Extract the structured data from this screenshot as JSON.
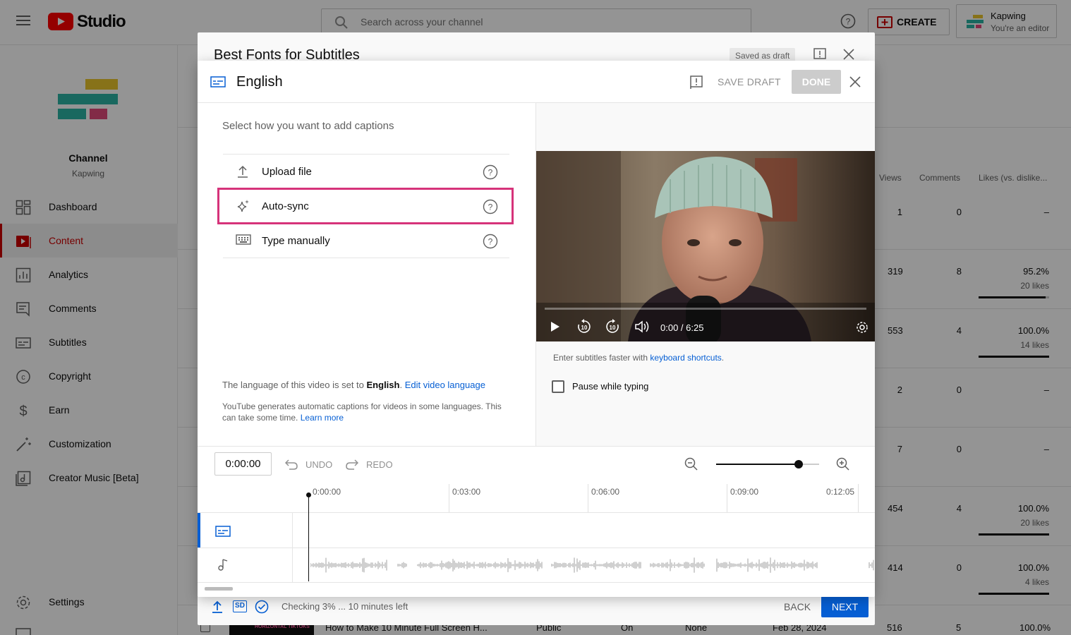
{
  "topbar": {
    "logo_text": "Studio",
    "search_placeholder": "Search across your channel",
    "create_label": "CREATE",
    "account_name": "Kapwing",
    "account_role": "You're an editor"
  },
  "sidebar": {
    "channel_label": "Channel",
    "channel_name": "Kapwing",
    "items": [
      {
        "label": "Dashboard",
        "icon": "dashboard-icon"
      },
      {
        "label": "Content",
        "icon": "content-icon"
      },
      {
        "label": "Analytics",
        "icon": "analytics-icon"
      },
      {
        "label": "Comments",
        "icon": "comments-icon"
      },
      {
        "label": "Subtitles",
        "icon": "subtitles-icon"
      },
      {
        "label": "Copyright",
        "icon": "copyright-icon"
      },
      {
        "label": "Earn",
        "icon": "dollar-icon"
      },
      {
        "label": "Customization",
        "icon": "magic-wand-icon"
      },
      {
        "label": "Creator Music [Beta]",
        "icon": "music-icon"
      }
    ],
    "settings_label": "Settings"
  },
  "table": {
    "headers": [
      "Views",
      "Comments",
      "Likes (vs. dislike..."
    ],
    "rows": [
      {
        "views": "1",
        "comments": "0",
        "likes": "–",
        "likes_sub": "",
        "ratio": null
      },
      {
        "views": "319",
        "comments": "8",
        "likes": "95.2%",
        "likes_sub": "20 likes",
        "ratio": 0.952
      },
      {
        "views": "553",
        "comments": "4",
        "likes": "100.0%",
        "likes_sub": "14 likes",
        "ratio": 1.0
      },
      {
        "views": "2",
        "comments": "0",
        "likes": "–",
        "likes_sub": "",
        "ratio": null
      },
      {
        "views": "7",
        "comments": "0",
        "likes": "–",
        "likes_sub": "",
        "ratio": null
      },
      {
        "views": "454",
        "comments": "4",
        "likes": "100.0%",
        "likes_sub": "20 likes",
        "ratio": 1.0
      },
      {
        "views": "414",
        "comments": "0",
        "likes": "100.0%",
        "likes_sub": "4 likes",
        "ratio": 1.0
      }
    ],
    "last_row": {
      "thumb_text": "HORIZONTAL TIKTOKS",
      "title": "How to Make 10 Minute Full Screen H...",
      "visibility": "Public",
      "monetization": "On",
      "restrictions": "None",
      "date": "Feb 28, 2024",
      "views": "516",
      "comments": "5",
      "likes": "100.0%"
    }
  },
  "back_dialog": {
    "title": "Best Fonts for Subtitles",
    "saved_status": "Saved as draft",
    "upload_status": "Checking 3% ... 10 minutes left",
    "back_label": "BACK",
    "next_label": "NEXT",
    "sd_badge": "SD"
  },
  "dialog": {
    "title": "English",
    "save_draft_label": "SAVE DRAFT",
    "done_label": "DONE",
    "prompt": "Select how you want to add captions",
    "options": [
      {
        "label": "Upload file",
        "icon": "upload-icon"
      },
      {
        "label": "Auto-sync",
        "icon": "sparkle-icon"
      },
      {
        "label": "Type manually",
        "icon": "keyboard-icon"
      }
    ],
    "language_prefix": "The language of this video is set to ",
    "language_value": "English",
    "language_suffix": ".",
    "edit_language_link": "Edit video language",
    "auto_caption_text": "YouTube generates automatic captions for videos in some languages. This can take some time.",
    "learn_more_link": "Learn more",
    "player": {
      "time": "0:00 / 6:25",
      "progress": 0.0
    },
    "shortcuts_prefix": "Enter subtitles faster with ",
    "shortcuts_link": "keyboard shortcuts",
    "shortcuts_suffix": ".",
    "pause_label": "Pause while typing",
    "pause_checked": false
  },
  "timeline": {
    "timecode": "0:00:00",
    "undo_label": "UNDO",
    "redo_label": "REDO",
    "zoom_level": 0.8,
    "markers": [
      "0:00:00",
      "0:03:00",
      "0:06:00",
      "0:09:00",
      "0:12:05"
    ]
  },
  "colors": {
    "accent_red": "#cc0000",
    "link_blue": "#065fd4",
    "highlight_pink": "#d6337a",
    "done_disabled": "#cccccc"
  }
}
